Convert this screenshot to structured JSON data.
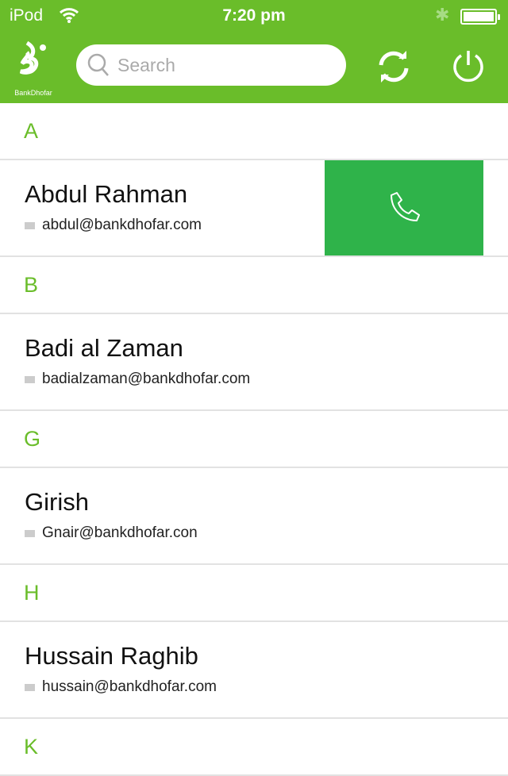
{
  "status": {
    "carrier": "iPod",
    "time": "7:20 pm",
    "battery_level": 1.0
  },
  "header": {
    "brand": "BankDhofar",
    "search_placeholder": "Search",
    "colors": {
      "header": "#6abd2a",
      "call": "#2fb34a"
    }
  },
  "sections": [
    {
      "letter": "A",
      "contacts": [
        {
          "name": "Abdul Rahman",
          "email": "abdul@bankdhofar.com",
          "swiped": true
        }
      ]
    },
    {
      "letter": "B",
      "contacts": [
        {
          "name": "Badi al Zaman",
          "email": "badialzaman@bankdhofar.com"
        }
      ]
    },
    {
      "letter": "G",
      "contacts": [
        {
          "name": "Girish",
          "email": "Gnair@bankdhofar.con"
        }
      ]
    },
    {
      "letter": "H",
      "contacts": [
        {
          "name": "Hussain Raghib",
          "email": "hussain@bankdhofar.com"
        }
      ]
    },
    {
      "letter": "K",
      "contacts": []
    }
  ]
}
